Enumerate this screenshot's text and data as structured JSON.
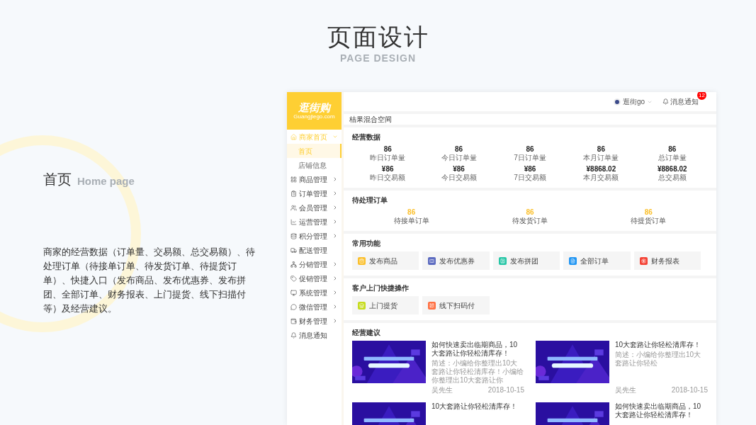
{
  "slide": {
    "title": "页面设计",
    "subtitle": "PAGE DESIGN",
    "section_title": "首页",
    "section_subtitle": "Home page",
    "description": "商家的经营数据（订单量、交易额、总交易额）、待处理订单（待接单订单、待发货订单、待提货订单）、快捷入口（发布商品、发布优惠券、发布拼团、全部订单、财务报表、上门提货、线下扫描付等）及经营建议。"
  },
  "app": {
    "logo": {
      "name": "逛街购",
      "domain": "Guangjiego.com"
    },
    "header": {
      "user": "逛街go",
      "notifications": "消息通知",
      "badge": "12"
    },
    "breadcrumb": "桔果混合空间",
    "sidebar": [
      {
        "kind": "group",
        "label": "商家首页",
        "expanded": true,
        "children": [
          {
            "label": "首页",
            "selected": true
          },
          {
            "label": "店铺信息",
            "selected": false
          }
        ]
      },
      {
        "kind": "group",
        "label": "商品管理",
        "expanded": false
      },
      {
        "kind": "group",
        "label": "订单管理",
        "expanded": false
      },
      {
        "kind": "group",
        "label": "会员管理",
        "expanded": false
      },
      {
        "kind": "group",
        "label": "运营管理",
        "expanded": false
      },
      {
        "kind": "group",
        "label": "积分管理",
        "expanded": false
      },
      {
        "kind": "link",
        "label": "配送管理"
      },
      {
        "kind": "group",
        "label": "分销管理",
        "expanded": false
      },
      {
        "kind": "group",
        "label": "促销管理",
        "expanded": false
      },
      {
        "kind": "group",
        "label": "系统管理",
        "expanded": false
      },
      {
        "kind": "group",
        "label": "微信管理",
        "expanded": false
      },
      {
        "kind": "group",
        "label": "财务管理",
        "expanded": false
      },
      {
        "kind": "link",
        "label": "消息通知"
      }
    ],
    "stats": {
      "title": "经营数据",
      "items": [
        {
          "value": "86",
          "label": "昨日订单量"
        },
        {
          "value": "86",
          "label": "今日订单量"
        },
        {
          "value": "86",
          "label": "7日订单量"
        },
        {
          "value": "86",
          "label": "本月订单量"
        },
        {
          "value": "86",
          "label": "总订单量"
        },
        {
          "value": "¥86",
          "label": "昨日交易额"
        },
        {
          "value": "¥86",
          "label": "今日交易额"
        },
        {
          "value": "¥86",
          "label": "7日交易额"
        },
        {
          "value": "¥8868.02",
          "label": "本月交易额"
        },
        {
          "value": "¥8868.02",
          "label": "总交易额"
        }
      ]
    },
    "pending": {
      "title": "待处理订单",
      "items": [
        {
          "value": "86",
          "label": "待接单订单"
        },
        {
          "value": "86",
          "label": "待发货订单"
        },
        {
          "value": "86",
          "label": "待提货订单"
        }
      ]
    },
    "common": {
      "title": "常用功能",
      "items": [
        {
          "label": "发布商品",
          "color": "#fbc02d"
        },
        {
          "label": "发布优惠券",
          "color": "#5c6bc0"
        },
        {
          "label": "发布拼团",
          "color": "#26c6a6"
        },
        {
          "label": "全部订单",
          "color": "#2196f3"
        },
        {
          "label": "财务报表",
          "color": "#f44336"
        }
      ]
    },
    "visit": {
      "title": "客户上门快捷操作",
      "items": [
        {
          "label": "上门提货",
          "color": "#c6dc1e"
        },
        {
          "label": "线下扫码付",
          "color": "#ff7043"
        }
      ]
    },
    "advice": {
      "title": "经营建议",
      "articles": [
        {
          "title": "如何快速卖出临期商品，10大套路让你轻松清库存！",
          "summary": "简述：小编给你整理出10大套路让你轻松清库存！小编给你整理出10大套路让你",
          "author": "吴先生",
          "date": "2018-10-15"
        },
        {
          "title": "10大套路让你轻松清库存！",
          "summary": "简述：小编给你整理出10大套路让你轻松",
          "author": "吴先生",
          "date": "2018-10-15"
        },
        {
          "title": "10大套路让你轻松清库存！"
        },
        {
          "title": "如何快速卖出临期商品，10大套路让你轻松清库存！"
        }
      ]
    }
  }
}
